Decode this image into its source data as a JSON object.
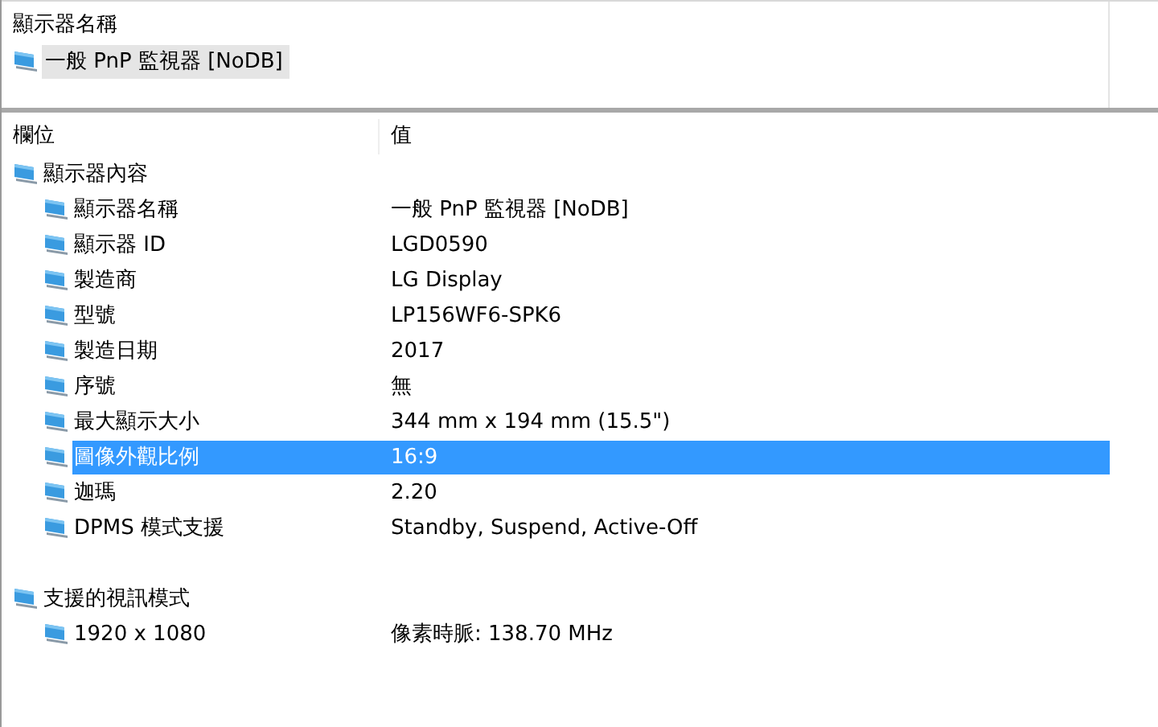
{
  "top_panel": {
    "label": "顯示器名稱",
    "monitors": [
      {
        "name": "一般 PnP 監視器 [NoDB]",
        "selected": true
      }
    ]
  },
  "table": {
    "columns": [
      "欄位",
      "值"
    ],
    "groups": [
      {
        "field": "顯示器內容",
        "children": [
          {
            "field": "顯示器名稱",
            "value": "一般 PnP 監視器 [NoDB]",
            "selected": false
          },
          {
            "field": "顯示器 ID",
            "value": "LGD0590",
            "selected": false
          },
          {
            "field": "製造商",
            "value": "LG Display",
            "selected": false
          },
          {
            "field": "型號",
            "value": "LP156WF6-SPK6",
            "selected": false
          },
          {
            "field": "製造日期",
            "value": "2017",
            "selected": false
          },
          {
            "field": "序號",
            "value": "無",
            "selected": false
          },
          {
            "field": "最大顯示大小",
            "value": "344 mm x 194 mm (15.5\")",
            "selected": false
          },
          {
            "field": "圖像外觀比例",
            "value": "16:9",
            "selected": true
          },
          {
            "field": "迦瑪",
            "value": "2.20",
            "selected": false
          },
          {
            "field": "DPMS 模式支援",
            "value": "Standby, Suspend, Active-Off",
            "selected": false
          }
        ]
      },
      {
        "field": "支援的視訊模式",
        "children": [
          {
            "field": "1920 x 1080",
            "value": "像素時脈: 138.70 MHz",
            "selected": false
          }
        ]
      }
    ]
  }
}
